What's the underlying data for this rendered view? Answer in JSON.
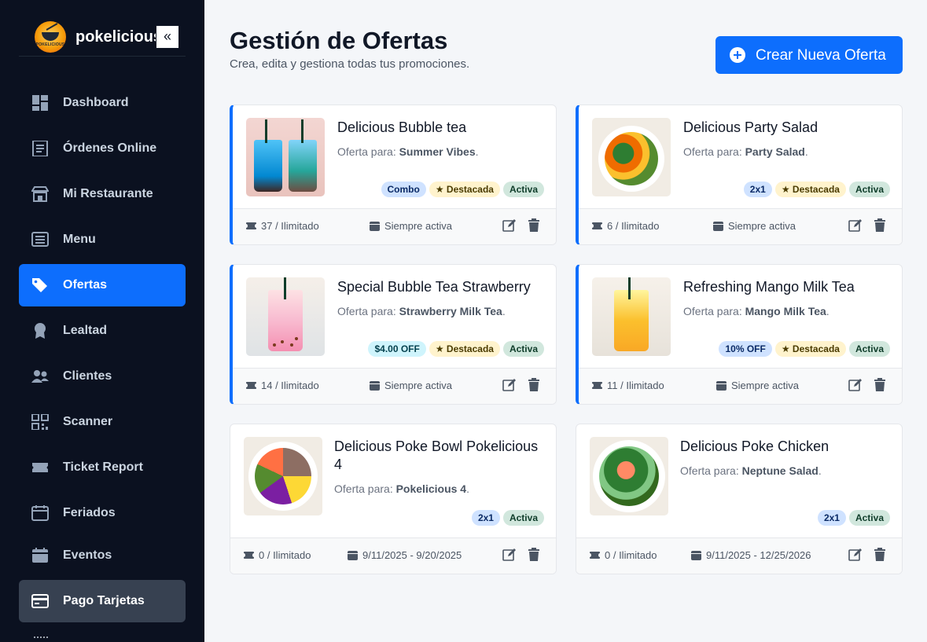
{
  "brand": {
    "name": "pokelicious",
    "logo_text": "POKELICIOUS",
    "collapse_icon": "«"
  },
  "sidebar": {
    "items": [
      {
        "label": "Dashboard",
        "icon": "dashboard-icon"
      },
      {
        "label": "Órdenes Online",
        "icon": "receipt-icon"
      },
      {
        "label": "Mi Restaurante",
        "icon": "store-icon"
      },
      {
        "label": "Menu",
        "icon": "menu-list-icon"
      },
      {
        "label": "Ofertas",
        "icon": "tag-icon",
        "active": true
      },
      {
        "label": "Lealtad",
        "icon": "award-icon"
      },
      {
        "label": "Clientes",
        "icon": "users-icon"
      },
      {
        "label": "Scanner",
        "icon": "qr-icon"
      },
      {
        "label": "Ticket Report",
        "icon": "ticket-icon"
      },
      {
        "label": "Feriados",
        "icon": "calendar-icon"
      },
      {
        "label": "Eventos",
        "icon": "calendar-event-icon"
      },
      {
        "label": "Pago Tarjetas",
        "icon": "credit-card-icon",
        "highlight": true
      }
    ]
  },
  "header": {
    "title": "Gestión de Ofertas",
    "subtitle": "Crea, edita y gestiona todas tus promociones.",
    "create_button": "Crear Nueva Oferta"
  },
  "offer_prefix": "Oferta para: ",
  "cards": [
    {
      "title": "Delicious Bubble tea",
      "target": "Summer Vibes",
      "badges": [
        {
          "text": "Combo",
          "style": "blue"
        },
        {
          "text": "★ Destacada",
          "style": "yellow"
        },
        {
          "text": "Activa",
          "style": "green"
        }
      ],
      "uses": "37 / Ilimitado",
      "dates": "Siempre activa",
      "featured": true
    },
    {
      "title": "Delicious Party Salad",
      "target": "Party Salad",
      "badges": [
        {
          "text": "2x1",
          "style": "blue"
        },
        {
          "text": "★ Destacada",
          "style": "yellow"
        },
        {
          "text": "Activa",
          "style": "green"
        }
      ],
      "uses": "6 / Ilimitado",
      "dates": "Siempre activa",
      "featured": true
    },
    {
      "title": "Special Bubble Tea Strawberry",
      "target": "Strawberry Milk Tea",
      "badges": [
        {
          "text": "$4.00 OFF",
          "style": "cyan"
        },
        {
          "text": "★ Destacada",
          "style": "yellow"
        },
        {
          "text": "Activa",
          "style": "green"
        }
      ],
      "uses": "14 / Ilimitado",
      "dates": "Siempre activa",
      "featured": true
    },
    {
      "title": "Refreshing Mango Milk Tea",
      "target": "Mango Milk Tea",
      "badges": [
        {
          "text": "10% OFF",
          "style": "blue"
        },
        {
          "text": "★ Destacada",
          "style": "yellow"
        },
        {
          "text": "Activa",
          "style": "green"
        }
      ],
      "uses": "11 / Ilimitado",
      "dates": "Siempre activa",
      "featured": true
    },
    {
      "title": "Delicious Poke Bowl Pokelicious 4",
      "target": "Pokelicious 4",
      "badges": [
        {
          "text": "2x1",
          "style": "blue"
        },
        {
          "text": "Activa",
          "style": "green"
        }
      ],
      "uses": "0 / Ilimitado",
      "dates": "9/11/2025 - 9/20/2025",
      "featured": false
    },
    {
      "title": "Delicious Poke Chicken",
      "target": "Neptune Salad",
      "badges": [
        {
          "text": "2x1",
          "style": "blue"
        },
        {
          "text": "Activa",
          "style": "green"
        }
      ],
      "uses": "0 / Ilimitado",
      "dates": "9/11/2025 - 12/25/2026",
      "featured": false
    }
  ],
  "colors": {
    "sidebar_bg": "#0b1120",
    "accent": "#0d6efd",
    "active_item": "#0d6efd"
  }
}
